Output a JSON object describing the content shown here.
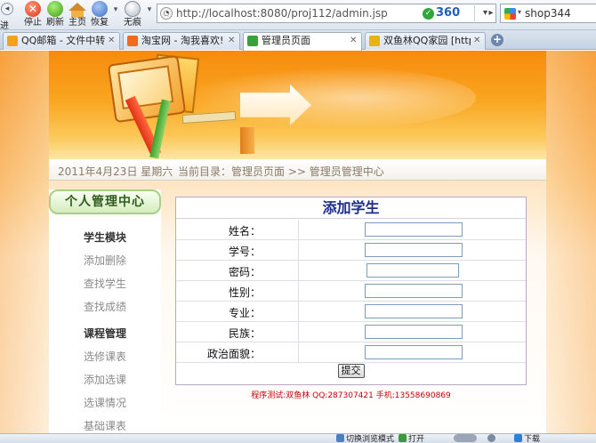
{
  "browser": {
    "back_label": "进",
    "toolbar": {
      "stop_label": "停止",
      "refresh_label": "刷新",
      "home_label": "主页",
      "restore_label": "恢复",
      "noimage_label": "无痕"
    },
    "address": {
      "url": "http://localhost:8080/proj112/admin.jsp",
      "brand_360": "360"
    },
    "search": {
      "value": "shop344"
    },
    "tabs": [
      {
        "label": "QQ邮箱 - 文件中转站",
        "icon": "qq-mail-icon",
        "color": "#f2a31a"
      },
      {
        "label": "淘宝网 - 淘我喜欢!",
        "icon": "taobao-icon",
        "color": "#f26a1b"
      },
      {
        "label": "管理员页面",
        "icon": "page-icon",
        "color": "#3aa13a",
        "active": true
      },
      {
        "label": "双鱼林QQ家园 [http:/...",
        "icon": "qq-home-icon",
        "color": "#e8b20f"
      }
    ],
    "status": {
      "mode": "切换浏览模式",
      "open": "打开",
      "download": "下载"
    }
  },
  "page": {
    "nav": {
      "date": "2011年4月23日  星期六",
      "breadcrumb": "当前目录：管理员页面 >> 管理员管理中心"
    },
    "sidebar": {
      "title": "个人管理中心",
      "sections": [
        {
          "title": "学生模块",
          "items": [
            "添加删除",
            "查找学生",
            "查找成绩"
          ]
        },
        {
          "title": "课程管理",
          "items": [
            "选修课表",
            "添加选课",
            "选课情况",
            "基础课表"
          ]
        }
      ]
    },
    "form": {
      "title": "添加学生",
      "fields": [
        {
          "label": "姓名：",
          "value": ""
        },
        {
          "label": "学号：",
          "value": ""
        },
        {
          "label": "密码：",
          "value": ""
        },
        {
          "label": "性别：",
          "value": ""
        },
        {
          "label": "专业：",
          "value": ""
        },
        {
          "label": "民族：",
          "value": ""
        },
        {
          "label": "政治面貌：",
          "value": ""
        }
      ],
      "submit_label": "提交"
    },
    "footer": "程序测试:双鱼林 QQ:287307421 手机:13558690869"
  }
}
